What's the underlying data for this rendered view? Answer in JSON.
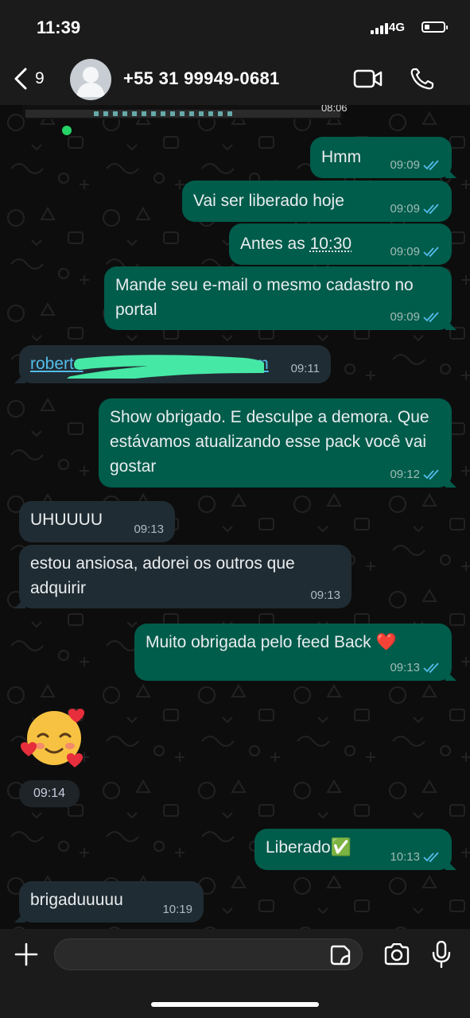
{
  "status_bar": {
    "time": "11:39",
    "network": "4G"
  },
  "header": {
    "back_count": "9",
    "contact": "+55 31 99949-0681"
  },
  "previous_media": {
    "time": "08:06"
  },
  "messages": [
    {
      "dir": "out",
      "text": "Hmm",
      "time": "09:09"
    },
    {
      "dir": "out",
      "text": "Vai ser liberado hoje",
      "time": "09:09"
    },
    {
      "dir": "out",
      "text_pre": "Antes as ",
      "text_link": "10:30",
      "time": "09:09"
    },
    {
      "dir": "out",
      "text": "Mande seu e-mail o mesmo cadastro no portal",
      "time": "09:09"
    },
    {
      "dir": "in",
      "link_start": "roberta",
      "link_end": "om",
      "time": "09:11"
    },
    {
      "dir": "out",
      "text": "Show obrigado. E desculpe a demora. Que estávamos atualizando esse pack você vai gostar",
      "time": "09:12"
    },
    {
      "dir": "in",
      "text": "UHUUUU",
      "time": "09:13"
    },
    {
      "dir": "in",
      "text": "estou ansiosa, adorei os outros que adquirir",
      "time": "09:13"
    },
    {
      "dir": "out",
      "text": "Muito obrigada pelo feed Back ❤️",
      "time": "09:13"
    },
    {
      "dir": "in",
      "emoji": "🥰",
      "time": "09:14"
    },
    {
      "dir": "out",
      "text": "Liberado✅",
      "time": "10:13"
    },
    {
      "dir": "in",
      "text": "brigaduuuuu",
      "time": "10:19"
    }
  ],
  "composer": {
    "placeholder": ""
  },
  "colors": {
    "outgoing": "#005c4b",
    "incoming": "#202c33",
    "read_ticks": "#53bdeb",
    "online": "#25d366"
  }
}
